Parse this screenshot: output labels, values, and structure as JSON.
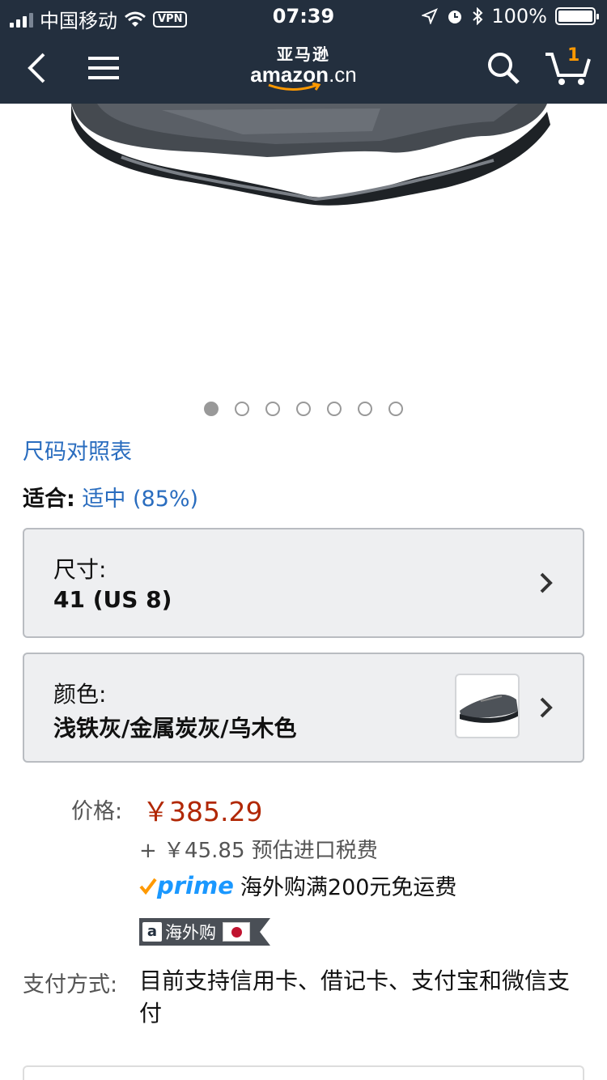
{
  "status_bar": {
    "carrier": "中国移动",
    "vpn": "VPN",
    "time": "07:39",
    "battery": "100%"
  },
  "nav": {
    "logo_cn": "亚马逊",
    "logo_en": "amazon",
    "logo_suffix": ".cn",
    "cart_count": "1"
  },
  "gallery": {
    "total_images": 7,
    "active_index": 0
  },
  "size_chart_link": "尺码对照表",
  "fit": {
    "label": "适合:",
    "value": "适中 (85%)"
  },
  "size_selector": {
    "title": "尺寸:",
    "value": "41 (US 8)"
  },
  "color_selector": {
    "title": "颜色:",
    "value": "浅铁灰/金属炭灰/乌木色"
  },
  "price": {
    "label": "价格:",
    "value": "￥385.29",
    "tax": "+ ￥45.85 预估进口税费",
    "prime_text": "prime",
    "prime_note": "海外购满200元免运费",
    "badge_text": "海外购"
  },
  "payment": {
    "label": "支付方式:",
    "value": "目前支持信用卡、借记卡、支付宝和微信支付"
  },
  "colors": {
    "nav_bg": "#232f3e",
    "link": "#2a6dbf",
    "price": "#b12704",
    "prime_blue": "#1a98ff",
    "amazon_orange": "#ff9900"
  }
}
